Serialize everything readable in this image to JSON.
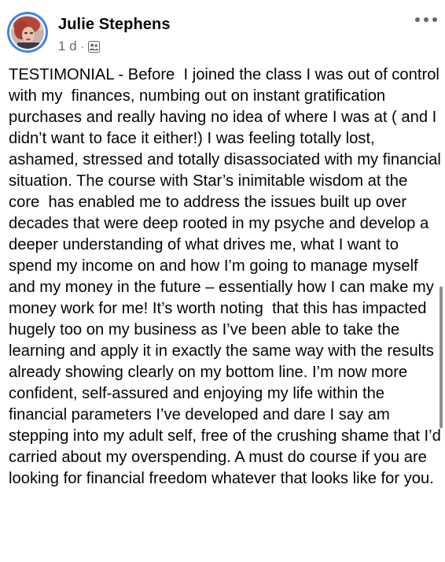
{
  "post": {
    "author": "Julie Stephens",
    "time": "1 d",
    "separator": "·",
    "privacy_icon": "friends-icon",
    "more_icon": "more-options-icon",
    "text": "TESTIMONIAL - Before  I joined the class I was out of control with my  finances, numbing out on instant gratification purchases and really having no idea of where I was at ( and I didn’t want to face it either!) I was feeling totally lost, ashamed, stressed and totally disassociated with my financial situation. The course with Star’s inimitable wisdom at the core  has enabled me to address the issues built up over decades that were deep rooted in my psyche and develop a deeper understanding of what drives me, what I want to spend my income on and how I’m going to manage myself and my money in the future – essentially how I can make my money work for me! It’s worth noting  that this has impacted hugely too on my business as I’ve been able to take the learning and apply it in exactly the same way with the results already showing clearly on my bottom line. I’m now more confident, self-assured and enjoying my life within the financial parameters I’ve developed and dare I say am stepping into my adult self, free of the crushing shame that I’d  carried about my overspending. A must do course if you are looking for financial freedom whatever that looks like for you."
  },
  "colors": {
    "avatar_ring": "#3b86e6",
    "meta_text": "#65676b",
    "body_text": "#050505"
  }
}
